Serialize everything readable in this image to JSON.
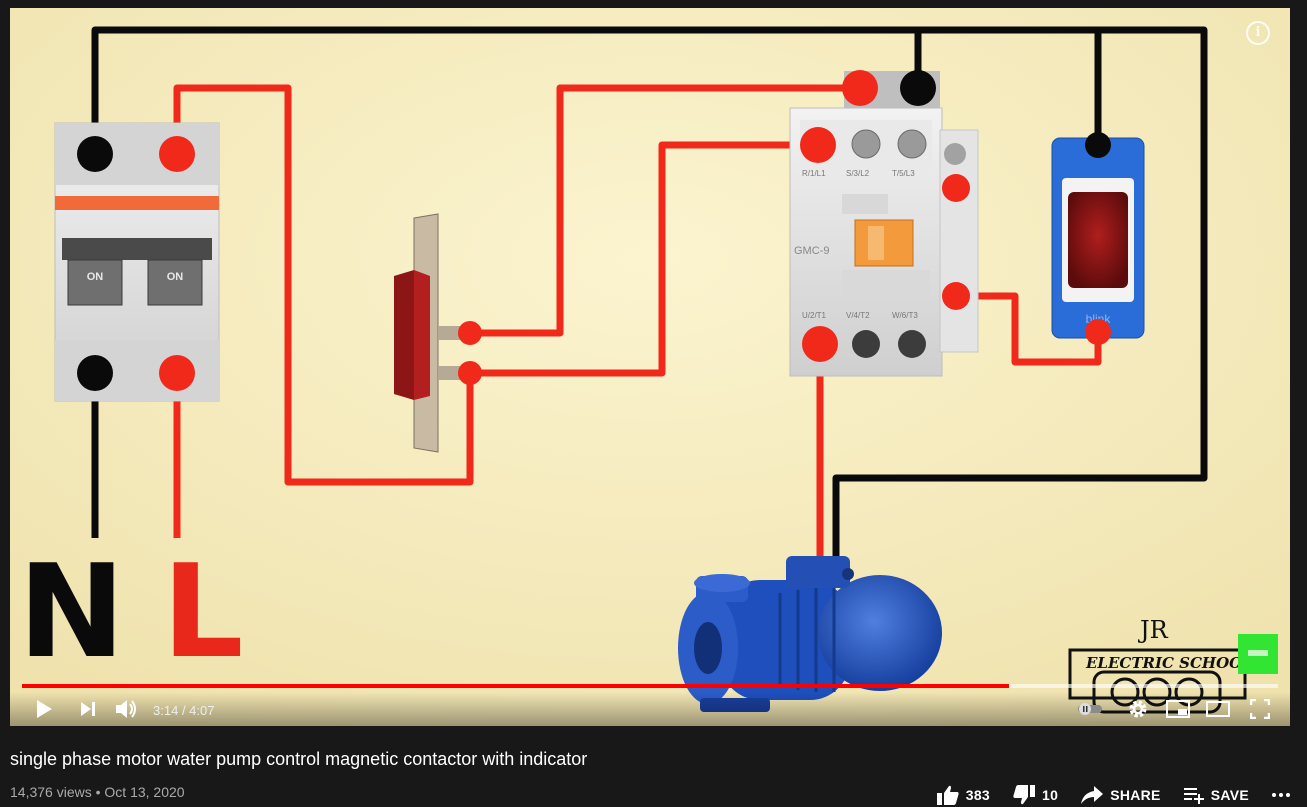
{
  "player": {
    "time_current": "3:14",
    "time_total": "4:07",
    "progress_fraction": 0.786,
    "loaded_fraction": 1.0,
    "info_glyph": "i"
  },
  "overlay": {
    "breaker_left_on": "ON",
    "breaker_right_on": "ON",
    "contactor_model": "GMC-9",
    "contactor_top_terminals": [
      "R/1/L1",
      "S/3/L2",
      "T/5/L3"
    ],
    "contactor_bottom_terminals": [
      "U/2/T1",
      "V/4/T2",
      "W/6/T3"
    ],
    "neutral_letter": "N",
    "live_letter": "L",
    "indicator_brand": "blink",
    "logo_initials": "JR",
    "logo_text": "ELECTRIC SCHOOL"
  },
  "video": {
    "title": "single phase motor water pump control magnetic contactor with indicator",
    "views": "14,376 views",
    "date": "Oct 13, 2020",
    "likes": "383",
    "dislikes": "10",
    "share_label": "SHARE",
    "save_label": "SAVE"
  },
  "colors": {
    "background": "#181818",
    "progress": "#ff0000",
    "scene_bg": "#f8f0c4",
    "wire_red": "#f0291b",
    "wire_black": "#0a0a0a"
  },
  "icons": [
    "play-icon",
    "next-icon",
    "volume-icon",
    "settings-icon",
    "miniplayer-icon",
    "theater-icon",
    "fullscreen-icon",
    "thumb-up-icon",
    "thumb-down-icon",
    "share-icon",
    "save-icon",
    "more-icon",
    "info-icon"
  ]
}
